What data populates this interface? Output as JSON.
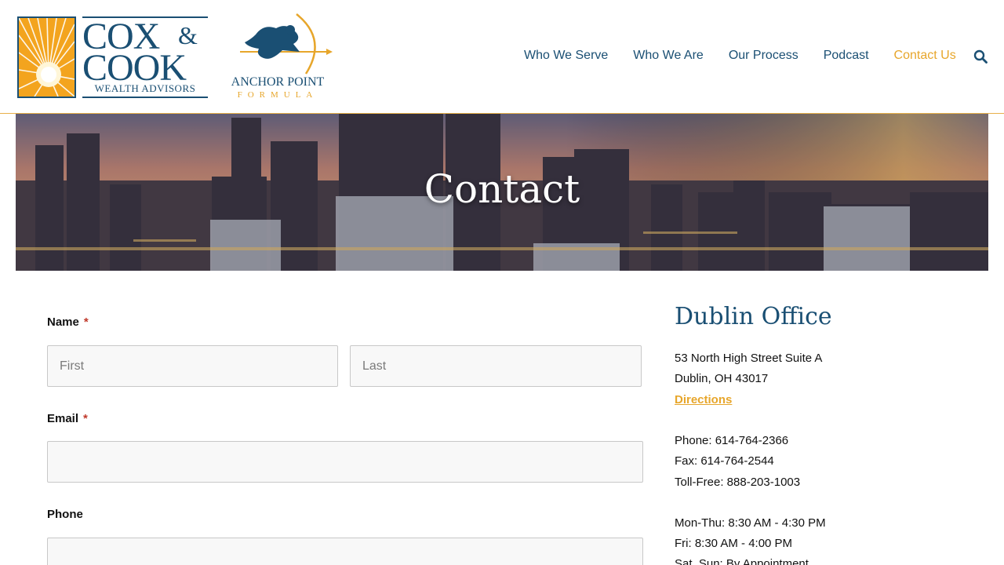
{
  "brand": {
    "cox_line1": "COX",
    "cox_amp": "&",
    "cox_line2": "COOK",
    "cox_sub": "WEALTH ADVISORS",
    "anchor_name": "ANCHOR POINT",
    "anchor_formula": "FORMULA"
  },
  "nav": {
    "items": [
      {
        "label": "Who We Serve"
      },
      {
        "label": "Who We Are"
      },
      {
        "label": "Our Process"
      },
      {
        "label": "Podcast"
      },
      {
        "label": "Contact Us"
      }
    ],
    "active_color": "#e7a62b",
    "link_color": "#1a4f73"
  },
  "hero": {
    "title": "Contact"
  },
  "form": {
    "name_label": "Name",
    "required_mark": "*",
    "first_placeholder": "First",
    "last_placeholder": "Last",
    "email_label": "Email",
    "phone_label": "Phone"
  },
  "office": {
    "title": "Dublin Office",
    "address1": "53 North High Street Suite A",
    "address2": "Dublin, OH 43017",
    "directions": "Directions",
    "phone": "Phone: 614-764-2366",
    "fax": "Fax: 614-764-2544",
    "tollfree": "Toll-Free: 888-203-1003",
    "hours1": "Mon-Thu: 8:30 AM - 4:30 PM",
    "hours2": "Fri: 8:30 AM - 4:00 PM",
    "hours3": "Sat, Sun: By Appointment"
  },
  "icons": {
    "search": "search-icon"
  }
}
